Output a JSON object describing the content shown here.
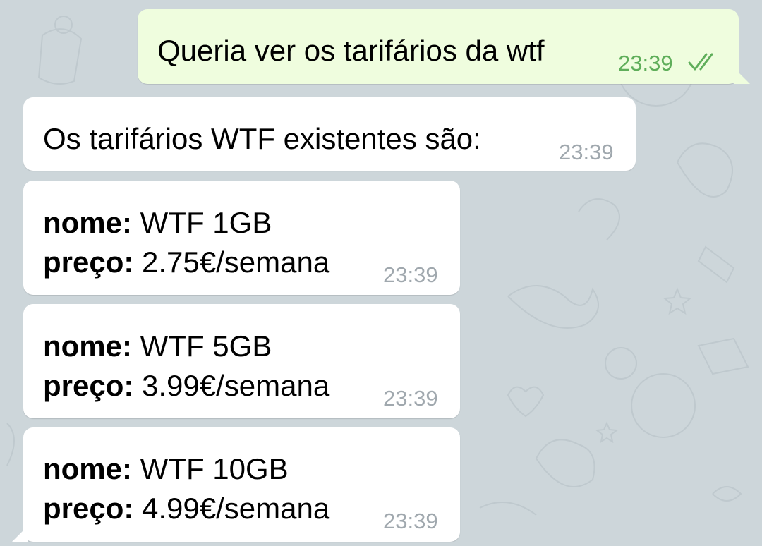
{
  "colors": {
    "outgoing_bubble": "#effdde",
    "incoming_bubble": "#ffffff",
    "chat_background": "#cdd6da",
    "time_incoming": "#a0a8ae",
    "time_outgoing": "#5fae5a"
  },
  "outgoing_message": {
    "text": "Queria ver os tarifários da wtf",
    "time": "23:39",
    "status_icon": "double-check-read-icon"
  },
  "intro_message": {
    "text": "Os tarifários WTF existentes são:",
    "time": "23:39"
  },
  "plan_messages": [
    {
      "name_label": "nome:",
      "name_value": " WTF 1GB",
      "price_label": "preço:",
      "price_value": " 2.75€/semana",
      "time": "23:39"
    },
    {
      "name_label": "nome:",
      "name_value": " WTF 5GB",
      "price_label": "preço:",
      "price_value": " 3.99€/semana",
      "time": "23:39"
    },
    {
      "name_label": "nome:",
      "name_value": " WTF 10GB",
      "price_label": "preço:",
      "price_value": " 4.99€/semana",
      "time": "23:39"
    }
  ]
}
